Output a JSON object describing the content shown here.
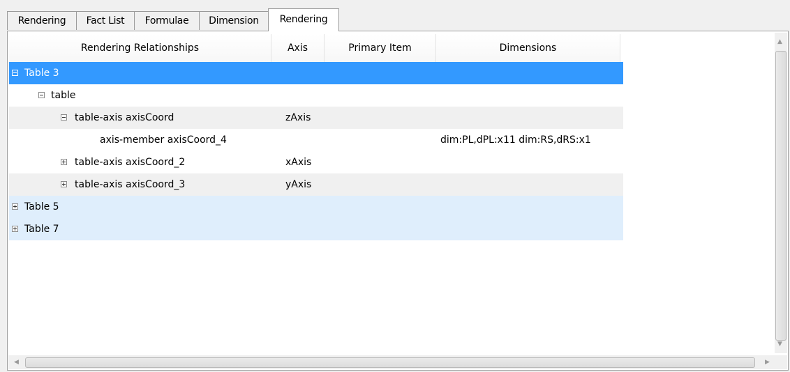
{
  "tabs": [
    "Rendering",
    "Fact List",
    "Formulae",
    "Dimension",
    "Rendering"
  ],
  "columns": [
    "Rendering Relationships",
    "Axis",
    "Primary Item",
    "Dimensions"
  ],
  "rows": [
    {
      "label": "Table 3",
      "axis": "",
      "dims": "",
      "expanded": true,
      "selected": true
    },
    {
      "label": "table",
      "axis": "",
      "dims": "",
      "expanded": true
    },
    {
      "label": "table-axis axisCoord",
      "axis": "zAxis",
      "dims": "",
      "expanded": true
    },
    {
      "label": "axis-member axisCoord_4",
      "axis": "",
      "dims": "dim:PL,dPL:x11 dim:RS,dRS:x1"
    },
    {
      "label": "table-axis axisCoord_2",
      "axis": "xAxis",
      "dims": "",
      "expanded": false
    },
    {
      "label": "table-axis axisCoord_3",
      "axis": "yAxis",
      "dims": "",
      "expanded": false
    },
    {
      "label": "Table 5",
      "axis": "",
      "dims": "",
      "expanded": false
    },
    {
      "label": "Table 7",
      "axis": "",
      "dims": "",
      "expanded": false
    }
  ],
  "colors": {
    "selection": "#3399ff",
    "light_row": "#dfeefc",
    "alt_row": "#f0f0f0"
  }
}
